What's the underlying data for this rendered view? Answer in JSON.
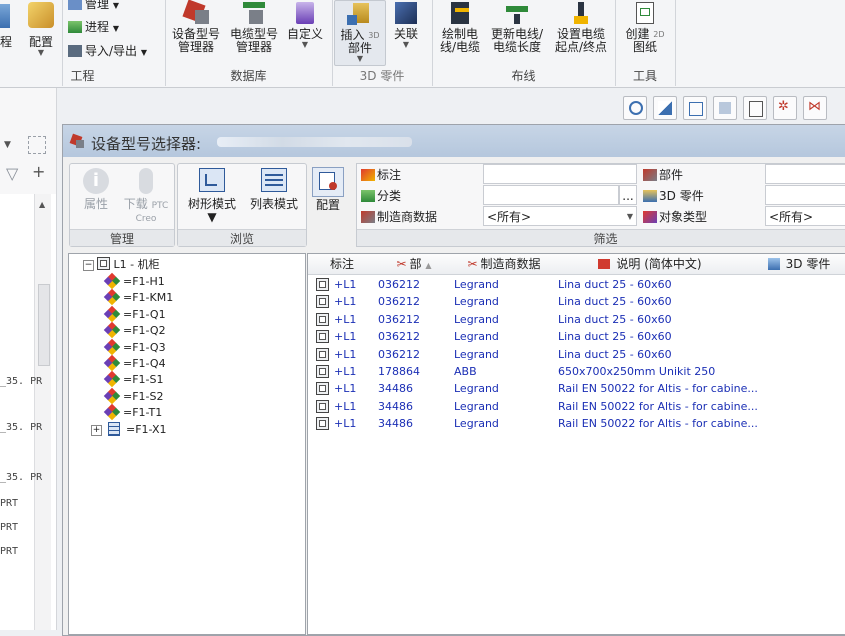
{
  "ribbon": {
    "manage_label": "管理",
    "process_label": "进程",
    "import_export_label": "导入/导出",
    "left_buttons": [
      "程",
      "配置"
    ],
    "db_buttons": [
      {
        "line1": "设备型号",
        "line2": "管理器"
      },
      {
        "line1": "电缆型号",
        "line2": "管理器"
      },
      {
        "line1": "自定义",
        "line2": ""
      }
    ],
    "insert_3d": {
      "line1": "插入",
      "sup": "3D",
      "line2": "部件"
    },
    "relate_label": "关联",
    "wire_buttons": [
      {
        "line1": "绘制电",
        "line2": "线/电缆"
      },
      {
        "line1": "更新电线/",
        "line2": "电缆长度"
      },
      {
        "line1": "设置电缆",
        "line2": "起点/终点"
      }
    ],
    "create2d": {
      "line1": "创建",
      "sup": "2D",
      "line2": "图纸"
    },
    "groups": [
      "工程",
      "数据库",
      "3D 零件",
      "布线",
      "工具"
    ]
  },
  "leftstrip": {
    "labels": [
      "_35. PR",
      "_35. PR",
      "_35. PR",
      "PRT",
      "PRT",
      "PRT"
    ]
  },
  "dialog": {
    "title": "设备型号选择器:",
    "manage_group": {
      "label": "管理",
      "attr_label": "属性",
      "download_label": "下载",
      "download_sup": "PTC",
      "download_sub": "Creo"
    },
    "browse_group": {
      "label": "浏览",
      "tree_mode": "树形模式",
      "list_mode": "列表模式"
    },
    "config_label": "配置",
    "filter": {
      "label": "筛选",
      "tag_label": "标注",
      "classify_label": "分类",
      "manufacturer_label": "制造商数据",
      "manufacturer_value": "<所有>",
      "part_label": "部件",
      "part3d_label": "3D 零件",
      "objtype_label": "对象类型",
      "objtype_value": "<所有>",
      "ellipsis": "..."
    },
    "tree": {
      "root": "L1 - 机柜",
      "children": [
        "=F1-H1",
        "=F1-KM1",
        "=F1-Q1",
        "=F1-Q2",
        "=F1-Q3",
        "=F1-Q4",
        "=F1-S1",
        "=F1-S2",
        "=F1-T1",
        "=F1-X1"
      ]
    },
    "list": {
      "columns": [
        "标注",
        "部",
        "制造商数据",
        "说明 (简体中文)",
        "3D 零件"
      ],
      "rows": [
        {
          "tag": "+L1",
          "part": "036212",
          "mfr": "Legrand",
          "desc": "Lina duct 25 - 60x60"
        },
        {
          "tag": "+L1",
          "part": "036212",
          "mfr": "Legrand",
          "desc": "Lina duct 25 - 60x60"
        },
        {
          "tag": "+L1",
          "part": "036212",
          "mfr": "Legrand",
          "desc": "Lina duct 25 - 60x60"
        },
        {
          "tag": "+L1",
          "part": "036212",
          "mfr": "Legrand",
          "desc": "Lina duct 25 - 60x60"
        },
        {
          "tag": "+L1",
          "part": "036212",
          "mfr": "Legrand",
          "desc": "Lina duct 25 - 60x60"
        },
        {
          "tag": "+L1",
          "part": "178864",
          "mfr": "ABB",
          "desc": "650x700x250mm Unikit 250"
        },
        {
          "tag": "+L1",
          "part": "34486",
          "mfr": "Legrand",
          "desc": "Rail EN 50022 for Altis - for cabine..."
        },
        {
          "tag": "+L1",
          "part": "34486",
          "mfr": "Legrand",
          "desc": "Rail EN 50022 for Altis - for cabine..."
        },
        {
          "tag": "+L1",
          "part": "34486",
          "mfr": "Legrand",
          "desc": "Rail EN 50022 for Altis - for cabine..."
        }
      ]
    }
  },
  "colors": {
    "row_text": "#1b2fb5",
    "title_bar": "#b5c7dd",
    "diamond_top": "#e03a2f",
    "diamond_right": "#2f8a3a",
    "diamond_bottom": "#f0b400",
    "diamond_left": "#6a3fb5"
  }
}
